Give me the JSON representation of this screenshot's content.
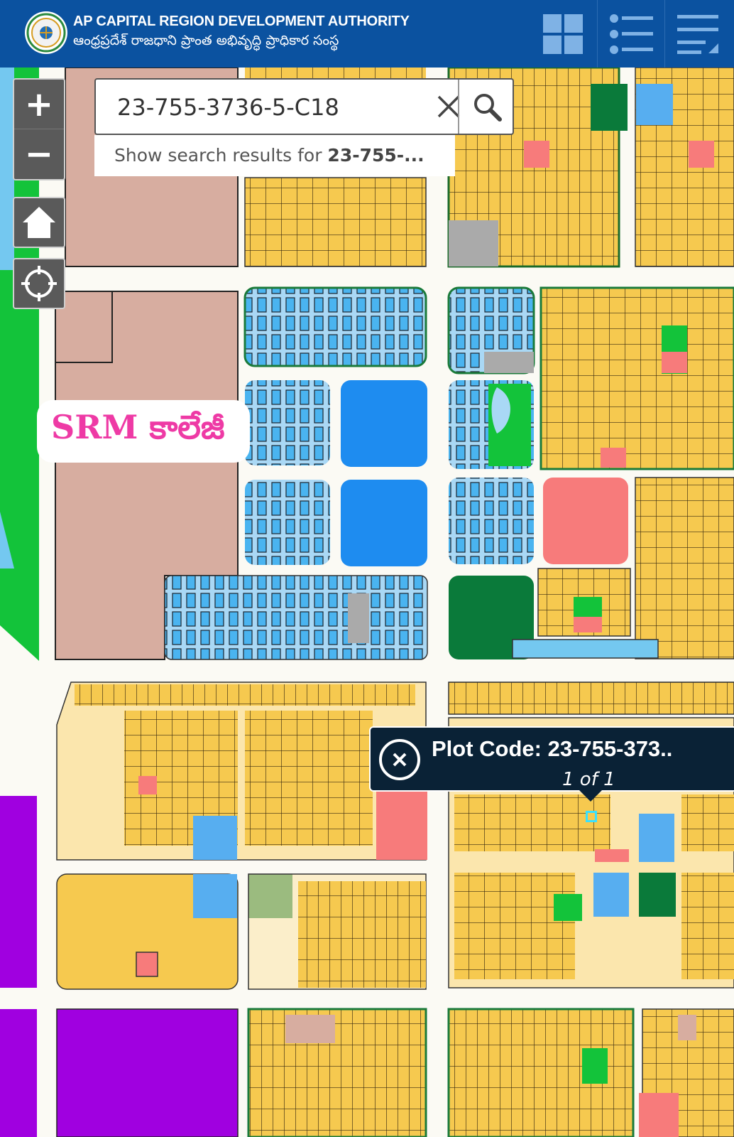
{
  "header": {
    "title_en": "AP CAPITAL REGION DEVELOPMENT AUTHORITY",
    "title_te": "ఆంధ్రప్రదేశ్ రాజధాని ప్రాంత అభివృద్ధి ప్రాధికార సంస్థ",
    "buttons": [
      "grid-icon",
      "list-icon",
      "menu-icon"
    ]
  },
  "search": {
    "value": "23-755-3736-5-C18",
    "suggestion_prefix": "Show search results for ",
    "suggestion_term": "23-755-..."
  },
  "map": {
    "label": "SRM కాలేజీ",
    "zoom_in": "+",
    "zoom_out": "−",
    "tools": [
      "home-icon",
      "locate-icon"
    ]
  },
  "popup": {
    "title": "Plot Code: 23-755-373..",
    "count": "1 of 1"
  },
  "colors": {
    "header": "#0b52a0",
    "residential": "#f6c94f",
    "residential_light": "#fbe6ad",
    "commercial_blue": "#4ab4f0",
    "water_blue": "#1e8cf0",
    "park_green": "#0a7a3a",
    "green_strip": "#13c33a",
    "institutional": "#d7ada0",
    "purple": "#a000e0",
    "pink": "#f77b7b",
    "popup_bg": "#0a2236",
    "srm_label": "#ee3aa5"
  }
}
